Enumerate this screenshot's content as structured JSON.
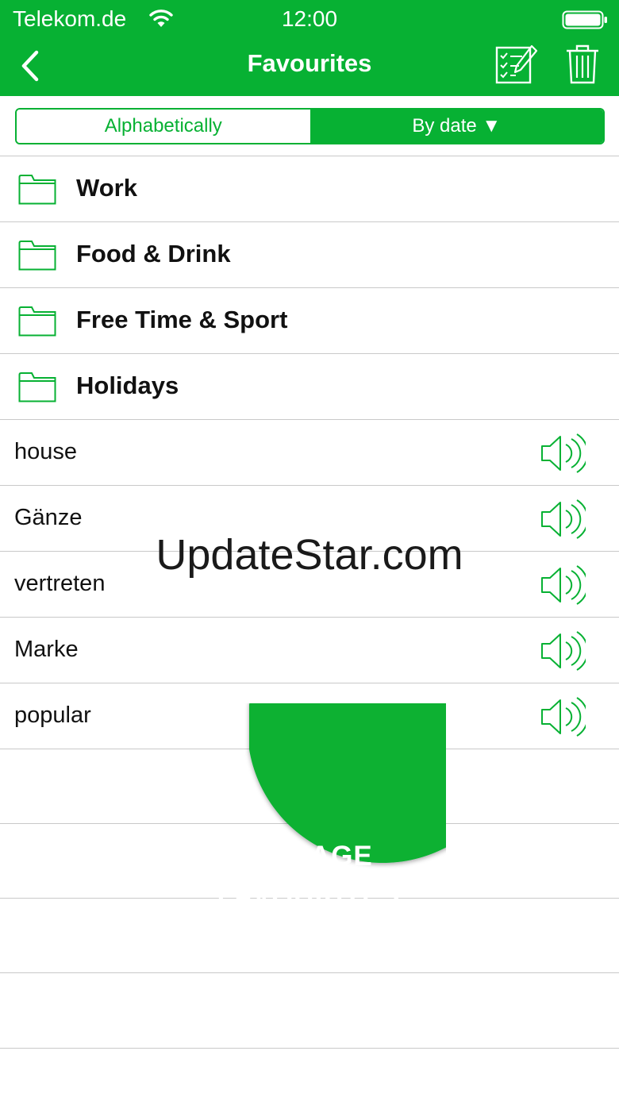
{
  "status_bar": {
    "carrier": "Telekom.de",
    "time": "12:00"
  },
  "nav": {
    "title": "Favourites"
  },
  "sort": {
    "alphabetically": "Alphabetically",
    "by_date": "By date ▼"
  },
  "folders": [
    {
      "label": "Work"
    },
    {
      "label": "Food & Drink"
    },
    {
      "label": "Free Time & Sport"
    },
    {
      "label": "Holidays"
    }
  ],
  "words": [
    {
      "label": "house"
    },
    {
      "label": "Gänze"
    },
    {
      "label": "vertreten"
    },
    {
      "label": "Marke"
    },
    {
      "label": "popular"
    }
  ],
  "watermark": "UpdateStar.com",
  "manage": {
    "line1": "MANAGE",
    "line2": "FAVOURITES"
  },
  "colors": {
    "accent": "#07b133",
    "divider": "#c9c9c9"
  }
}
